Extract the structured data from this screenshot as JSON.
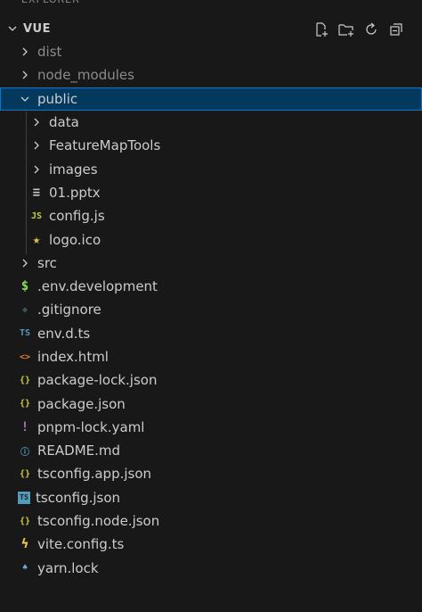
{
  "header": {
    "title": "EXPLORER"
  },
  "section": {
    "title": "VUE",
    "actions": [
      "new-file-icon",
      "new-folder-icon",
      "refresh-icon",
      "collapse-all-icon"
    ]
  },
  "tree": [
    {
      "label": "dist",
      "kind": "folder",
      "depth": 0,
      "expanded": false,
      "dim": true
    },
    {
      "label": "node_modules",
      "kind": "folder",
      "depth": 0,
      "expanded": false,
      "dim": true
    },
    {
      "label": "public",
      "kind": "folder",
      "depth": 0,
      "expanded": true,
      "selected": true
    },
    {
      "label": "data",
      "kind": "folder",
      "depth": 1,
      "expanded": false
    },
    {
      "label": "FeatureMapTools",
      "kind": "folder",
      "depth": 1,
      "expanded": false
    },
    {
      "label": "images",
      "kind": "folder",
      "depth": 1,
      "expanded": false
    },
    {
      "label": "01.pptx",
      "kind": "file",
      "depth": 1,
      "icon": "lines-icon",
      "glyph": "≡",
      "color": "#c5c5c5"
    },
    {
      "label": "config.js",
      "kind": "file",
      "depth": 1,
      "icon": "js-icon",
      "glyph": "JS",
      "color": "#cbcb41"
    },
    {
      "label": "logo.ico",
      "kind": "file",
      "depth": 1,
      "icon": "star-icon",
      "glyph": "★",
      "color": "#e2c541"
    },
    {
      "label": "src",
      "kind": "folder",
      "depth": 0,
      "expanded": false
    },
    {
      "label": ".env.development",
      "kind": "file",
      "depth": 0,
      "icon": "dollar-icon",
      "glyph": "$",
      "color": "#89e051"
    },
    {
      "label": ".gitignore",
      "kind": "file",
      "depth": 0,
      "icon": "git-icon",
      "glyph": "◆",
      "color": "#41535b"
    },
    {
      "label": "env.d.ts",
      "kind": "file",
      "depth": 0,
      "icon": "ts-icon",
      "glyph": "TS",
      "color": "#519aba"
    },
    {
      "label": "index.html",
      "kind": "file",
      "depth": 0,
      "icon": "html-icon",
      "glyph": "<>",
      "color": "#e37933"
    },
    {
      "label": "package-lock.json",
      "kind": "file",
      "depth": 0,
      "icon": "json-icon",
      "glyph": "{}",
      "color": "#cbcb41"
    },
    {
      "label": "package.json",
      "kind": "file",
      "depth": 0,
      "icon": "json-icon",
      "glyph": "{}",
      "color": "#cbcb41"
    },
    {
      "label": "pnpm-lock.yaml",
      "kind": "file",
      "depth": 0,
      "icon": "yaml-icon",
      "glyph": "!",
      "color": "#a074c4"
    },
    {
      "label": "README.md",
      "kind": "file",
      "depth": 0,
      "icon": "info-icon",
      "glyph": "ⓘ",
      "color": "#519aba"
    },
    {
      "label": "tsconfig.app.json",
      "kind": "file",
      "depth": 0,
      "icon": "json-icon",
      "glyph": "{}",
      "color": "#cbcb41"
    },
    {
      "label": "tsconfig.json",
      "kind": "file",
      "depth": 0,
      "icon": "tsconfig-icon",
      "glyph": "TS",
      "color": "#519aba"
    },
    {
      "label": "tsconfig.node.json",
      "kind": "file",
      "depth": 0,
      "icon": "json-icon",
      "glyph": "{}",
      "color": "#cbcb41"
    },
    {
      "label": "vite.config.ts",
      "kind": "file",
      "depth": 0,
      "icon": "vite-icon",
      "glyph": "ϟ",
      "color": "#f2c94c"
    },
    {
      "label": "yarn.lock",
      "kind": "file",
      "depth": 0,
      "icon": "yarn-icon",
      "glyph": "♠",
      "color": "#6fa8dc"
    }
  ]
}
